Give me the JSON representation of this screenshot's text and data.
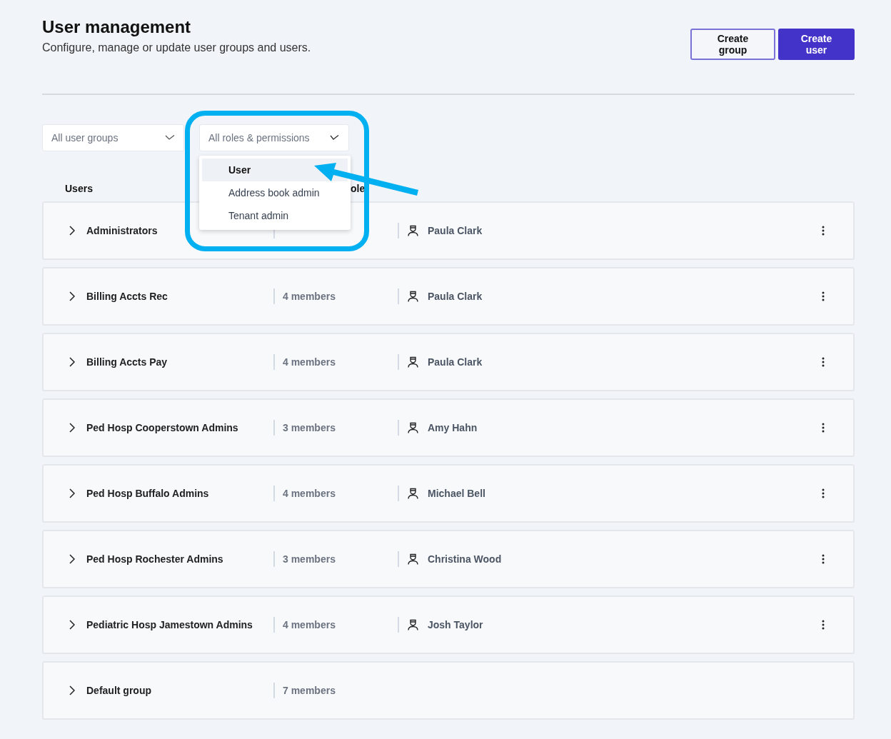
{
  "header": {
    "title": "User management",
    "subtitle": "Configure, manage or update user groups and users."
  },
  "actions": [
    {
      "label": "Create group",
      "kind": "secondary"
    },
    {
      "label": "Create user",
      "kind": "primary"
    }
  ],
  "filters": [
    {
      "placeholder": "All user groups",
      "expanded": false
    },
    {
      "placeholder": "All roles & permissions",
      "expanded": true
    }
  ],
  "dropdown": {
    "items": [
      {
        "label": "User",
        "selected": true
      },
      {
        "label": "Address book admin",
        "selected": false
      },
      {
        "label": "Tenant admin",
        "selected": false
      }
    ]
  },
  "table": {
    "columns": [
      "Users",
      "ole"
    ],
    "rows": [
      {
        "name": "Administrators",
        "owner": "Paula Clark"
      },
      {
        "name": "Billing Accts Rec",
        "members": "4 members",
        "owner": "Paula Clark"
      },
      {
        "name": "Billing Accts Pay",
        "members": "4 members",
        "owner": "Paula Clark"
      },
      {
        "name": "Ped Hosp Cooperstown Admins",
        "members": "3 members",
        "owner": "Amy Hahn"
      },
      {
        "name": "Ped Hosp Buffalo Admins",
        "members": "4 members",
        "owner": "Michael Bell"
      },
      {
        "name": "Ped Hosp Rochester Admins",
        "members": "3 members",
        "owner": "Christina Wood"
      },
      {
        "name": "Pediatric Hosp Jamestown Admins",
        "members": "4 members",
        "owner": "Josh Taylor"
      },
      {
        "name": "Default group",
        "members": "7 members"
      }
    ]
  }
}
